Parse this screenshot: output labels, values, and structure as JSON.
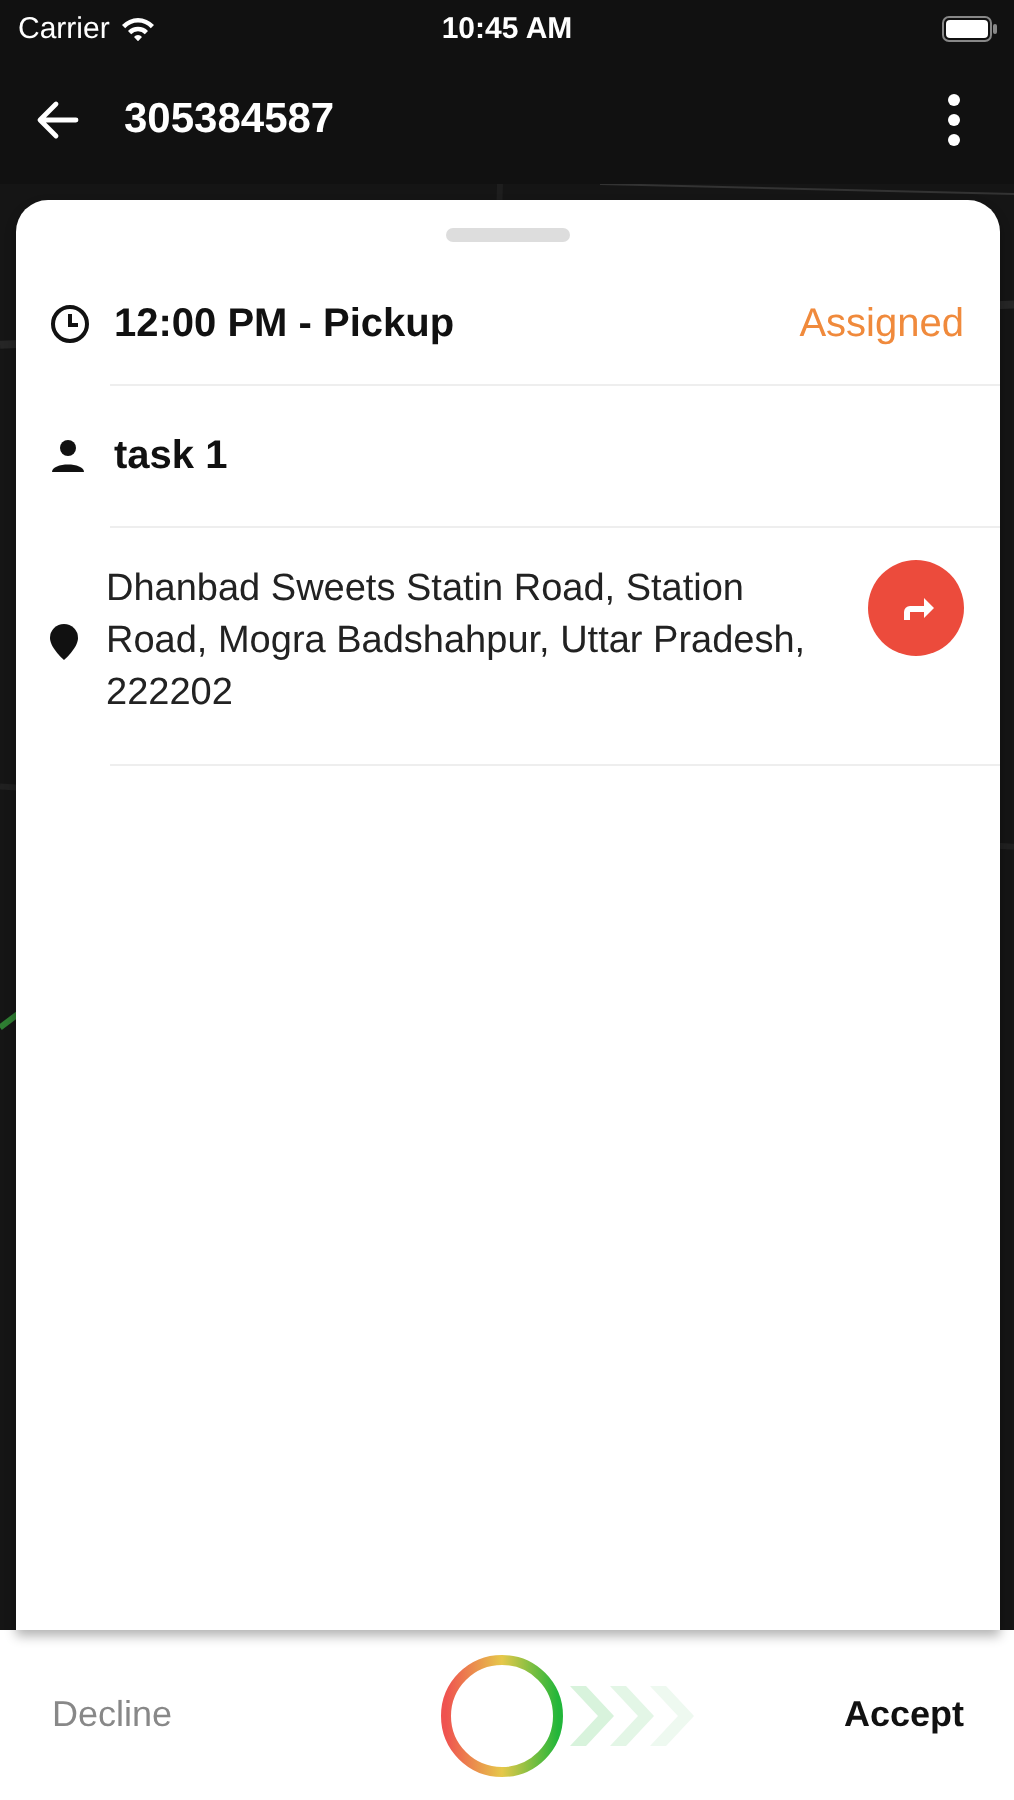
{
  "status_bar": {
    "carrier": "Carrier",
    "time": "10:45 AM"
  },
  "header": {
    "title": "305384587"
  },
  "task": {
    "time_label": "12:00 PM - Pickup",
    "status": "Assigned",
    "name": "task 1",
    "address": "Dhanbad Sweets Statin Road, Station Road, Mogra Badshahpur, Uttar Pradesh, 222202"
  },
  "actions": {
    "decline": "Decline",
    "accept": "Accept"
  }
}
